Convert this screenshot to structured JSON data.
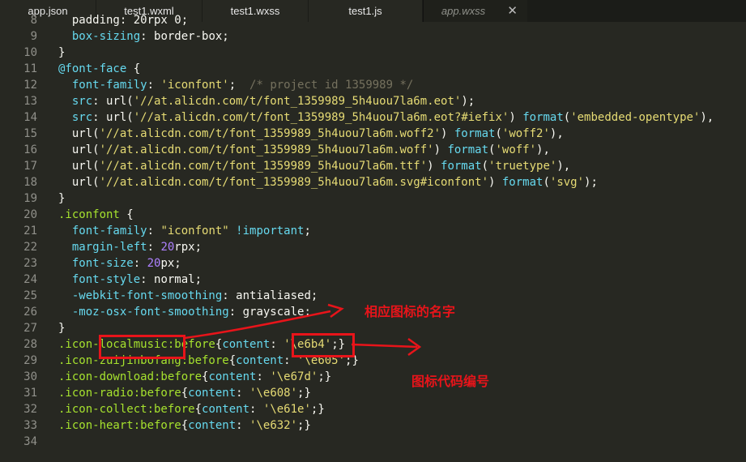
{
  "tabs": [
    {
      "label": "app.json",
      "active": true
    },
    {
      "label": "test1.wxml",
      "active": true
    },
    {
      "label": "test1.wxss",
      "active": true
    },
    {
      "label": "test1.js",
      "active": true
    },
    {
      "label": "app.wxss",
      "active": false
    }
  ],
  "close_glyph": "✕",
  "code_lines": [
    {
      "num": "8",
      "tokens": [
        {
          "t": "  padding: 20rpx 0;",
          "c": "plain"
        }
      ]
    },
    {
      "num": "9",
      "tokens": [
        {
          "t": "  ",
          "c": "plain"
        },
        {
          "t": "box-sizing",
          "c": "prop"
        },
        {
          "t": ": border-box;",
          "c": "plain"
        }
      ]
    },
    {
      "num": "10",
      "tokens": [
        {
          "t": "}",
          "c": "plain"
        }
      ]
    },
    {
      "num": "11",
      "tokens": [
        {
          "t": "@font-face",
          "c": "at"
        },
        {
          "t": " {",
          "c": "plain"
        }
      ]
    },
    {
      "num": "12",
      "tokens": [
        {
          "t": "  ",
          "c": "plain"
        },
        {
          "t": "font-family",
          "c": "prop"
        },
        {
          "t": ": ",
          "c": "plain"
        },
        {
          "t": "'iconfont'",
          "c": "str"
        },
        {
          "t": ";  ",
          "c": "plain"
        },
        {
          "t": "/* project id 1359989 */",
          "c": "com"
        }
      ]
    },
    {
      "num": "13",
      "tokens": [
        {
          "t": "  ",
          "c": "plain"
        },
        {
          "t": "src",
          "c": "prop"
        },
        {
          "t": ": url(",
          "c": "plain"
        },
        {
          "t": "'//at.alicdn.com/t/font_1359989_5h4uou7la6m.eot'",
          "c": "str"
        },
        {
          "t": ");",
          "c": "plain"
        }
      ]
    },
    {
      "num": "14",
      "tokens": [
        {
          "t": "  ",
          "c": "plain"
        },
        {
          "t": "src",
          "c": "prop"
        },
        {
          "t": ": url(",
          "c": "plain"
        },
        {
          "t": "'//at.alicdn.com/t/font_1359989_5h4uou7la6m.eot?#iefix'",
          "c": "str"
        },
        {
          "t": ") ",
          "c": "plain"
        },
        {
          "t": "format",
          "c": "fn"
        },
        {
          "t": "(",
          "c": "plain"
        },
        {
          "t": "'embedded-opentype'",
          "c": "str"
        },
        {
          "t": "),",
          "c": "plain"
        }
      ]
    },
    {
      "num": "15",
      "tokens": [
        {
          "t": "  url(",
          "c": "plain"
        },
        {
          "t": "'//at.alicdn.com/t/font_1359989_5h4uou7la6m.woff2'",
          "c": "str"
        },
        {
          "t": ") ",
          "c": "plain"
        },
        {
          "t": "format",
          "c": "fn"
        },
        {
          "t": "(",
          "c": "plain"
        },
        {
          "t": "'woff2'",
          "c": "str"
        },
        {
          "t": "),",
          "c": "plain"
        }
      ]
    },
    {
      "num": "16",
      "tokens": [
        {
          "t": "  url(",
          "c": "plain"
        },
        {
          "t": "'//at.alicdn.com/t/font_1359989_5h4uou7la6m.woff'",
          "c": "str"
        },
        {
          "t": ") ",
          "c": "plain"
        },
        {
          "t": "format",
          "c": "fn"
        },
        {
          "t": "(",
          "c": "plain"
        },
        {
          "t": "'woff'",
          "c": "str"
        },
        {
          "t": "),",
          "c": "plain"
        }
      ]
    },
    {
      "num": "17",
      "tokens": [
        {
          "t": "  url(",
          "c": "plain"
        },
        {
          "t": "'//at.alicdn.com/t/font_1359989_5h4uou7la6m.ttf'",
          "c": "str"
        },
        {
          "t": ") ",
          "c": "plain"
        },
        {
          "t": "format",
          "c": "fn"
        },
        {
          "t": "(",
          "c": "plain"
        },
        {
          "t": "'truetype'",
          "c": "str"
        },
        {
          "t": "),",
          "c": "plain"
        }
      ]
    },
    {
      "num": "18",
      "tokens": [
        {
          "t": "  url(",
          "c": "plain"
        },
        {
          "t": "'//at.alicdn.com/t/font_1359989_5h4uou7la6m.svg#iconfont'",
          "c": "str"
        },
        {
          "t": ") ",
          "c": "plain"
        },
        {
          "t": "format",
          "c": "fn"
        },
        {
          "t": "(",
          "c": "plain"
        },
        {
          "t": "'svg'",
          "c": "str"
        },
        {
          "t": ");",
          "c": "plain"
        }
      ]
    },
    {
      "num": "19",
      "tokens": [
        {
          "t": "}",
          "c": "plain"
        }
      ]
    },
    {
      "num": "20",
      "tokens": [
        {
          "t": ".iconfont",
          "c": "sel"
        },
        {
          "t": " {",
          "c": "plain"
        }
      ]
    },
    {
      "num": "21",
      "tokens": [
        {
          "t": "  ",
          "c": "plain"
        },
        {
          "t": "font-family",
          "c": "prop"
        },
        {
          "t": ": ",
          "c": "plain"
        },
        {
          "t": "\"iconfont\"",
          "c": "str"
        },
        {
          "t": " ",
          "c": "plain"
        },
        {
          "t": "!important",
          "c": "kw"
        },
        {
          "t": ";",
          "c": "plain"
        }
      ]
    },
    {
      "num": "22",
      "tokens": [
        {
          "t": "  ",
          "c": "plain"
        },
        {
          "t": "margin-left",
          "c": "prop"
        },
        {
          "t": ": ",
          "c": "plain"
        },
        {
          "t": "20",
          "c": "num"
        },
        {
          "t": "rpx;",
          "c": "plain"
        }
      ]
    },
    {
      "num": "23",
      "tokens": [
        {
          "t": "  ",
          "c": "plain"
        },
        {
          "t": "font-size",
          "c": "prop"
        },
        {
          "t": ": ",
          "c": "plain"
        },
        {
          "t": "20",
          "c": "num"
        },
        {
          "t": "px;",
          "c": "plain"
        }
      ]
    },
    {
      "num": "24",
      "tokens": [
        {
          "t": "  ",
          "c": "plain"
        },
        {
          "t": "font-style",
          "c": "prop"
        },
        {
          "t": ": normal;",
          "c": "plain"
        }
      ]
    },
    {
      "num": "25",
      "tokens": [
        {
          "t": "  ",
          "c": "plain"
        },
        {
          "t": "-webkit-font-smoothing",
          "c": "prop"
        },
        {
          "t": ": antialiased;",
          "c": "plain"
        }
      ]
    },
    {
      "num": "26",
      "tokens": [
        {
          "t": "  ",
          "c": "plain"
        },
        {
          "t": "-moz-osx-font-smoothing",
          "c": "prop"
        },
        {
          "t": ": grayscale;",
          "c": "plain"
        }
      ]
    },
    {
      "num": "27",
      "tokens": [
        {
          "t": "}",
          "c": "plain"
        }
      ]
    },
    {
      "num": "28",
      "tokens": [
        {
          "t": ".icon-localmusic:before",
          "c": "sel"
        },
        {
          "t": "{",
          "c": "plain"
        },
        {
          "t": "content",
          "c": "prop"
        },
        {
          "t": ": ",
          "c": "plain"
        },
        {
          "t": "'\\e6b4'",
          "c": "str"
        },
        {
          "t": ";}",
          "c": "plain"
        }
      ]
    },
    {
      "num": "29",
      "tokens": [
        {
          "t": ".icon-zuijinbofang:before",
          "c": "sel"
        },
        {
          "t": "{",
          "c": "plain"
        },
        {
          "t": "content",
          "c": "prop"
        },
        {
          "t": ": ",
          "c": "plain"
        },
        {
          "t": "'\\e605'",
          "c": "str"
        },
        {
          "t": ";}",
          "c": "plain"
        }
      ]
    },
    {
      "num": "30",
      "tokens": [
        {
          "t": ".icon-download:before",
          "c": "sel"
        },
        {
          "t": "{",
          "c": "plain"
        },
        {
          "t": "content",
          "c": "prop"
        },
        {
          "t": ": ",
          "c": "plain"
        },
        {
          "t": "'\\e67d'",
          "c": "str"
        },
        {
          "t": ";}",
          "c": "plain"
        }
      ]
    },
    {
      "num": "31",
      "tokens": [
        {
          "t": ".icon-radio:before",
          "c": "sel"
        },
        {
          "t": "{",
          "c": "plain"
        },
        {
          "t": "content",
          "c": "prop"
        },
        {
          "t": ": ",
          "c": "plain"
        },
        {
          "t": "'\\e608'",
          "c": "str"
        },
        {
          "t": ";}",
          "c": "plain"
        }
      ]
    },
    {
      "num": "32",
      "tokens": [
        {
          "t": ".icon-collect:before",
          "c": "sel"
        },
        {
          "t": "{",
          "c": "plain"
        },
        {
          "t": "content",
          "c": "prop"
        },
        {
          "t": ": ",
          "c": "plain"
        },
        {
          "t": "'\\e61e'",
          "c": "str"
        },
        {
          "t": ";}",
          "c": "plain"
        }
      ]
    },
    {
      "num": "33",
      "tokens": [
        {
          "t": ".icon-heart:before",
          "c": "sel"
        },
        {
          "t": "{",
          "c": "plain"
        },
        {
          "t": "content",
          "c": "prop"
        },
        {
          "t": ": ",
          "c": "plain"
        },
        {
          "t": "'\\e632'",
          "c": "str"
        },
        {
          "t": ";}",
          "c": "plain"
        }
      ]
    },
    {
      "num": "34",
      "tokens": []
    }
  ],
  "annotations": {
    "icon_name": "相应图标的名字",
    "icon_code": "图标代码编号"
  },
  "colors": {
    "background": "#272822",
    "annotation": "#e8141a"
  }
}
